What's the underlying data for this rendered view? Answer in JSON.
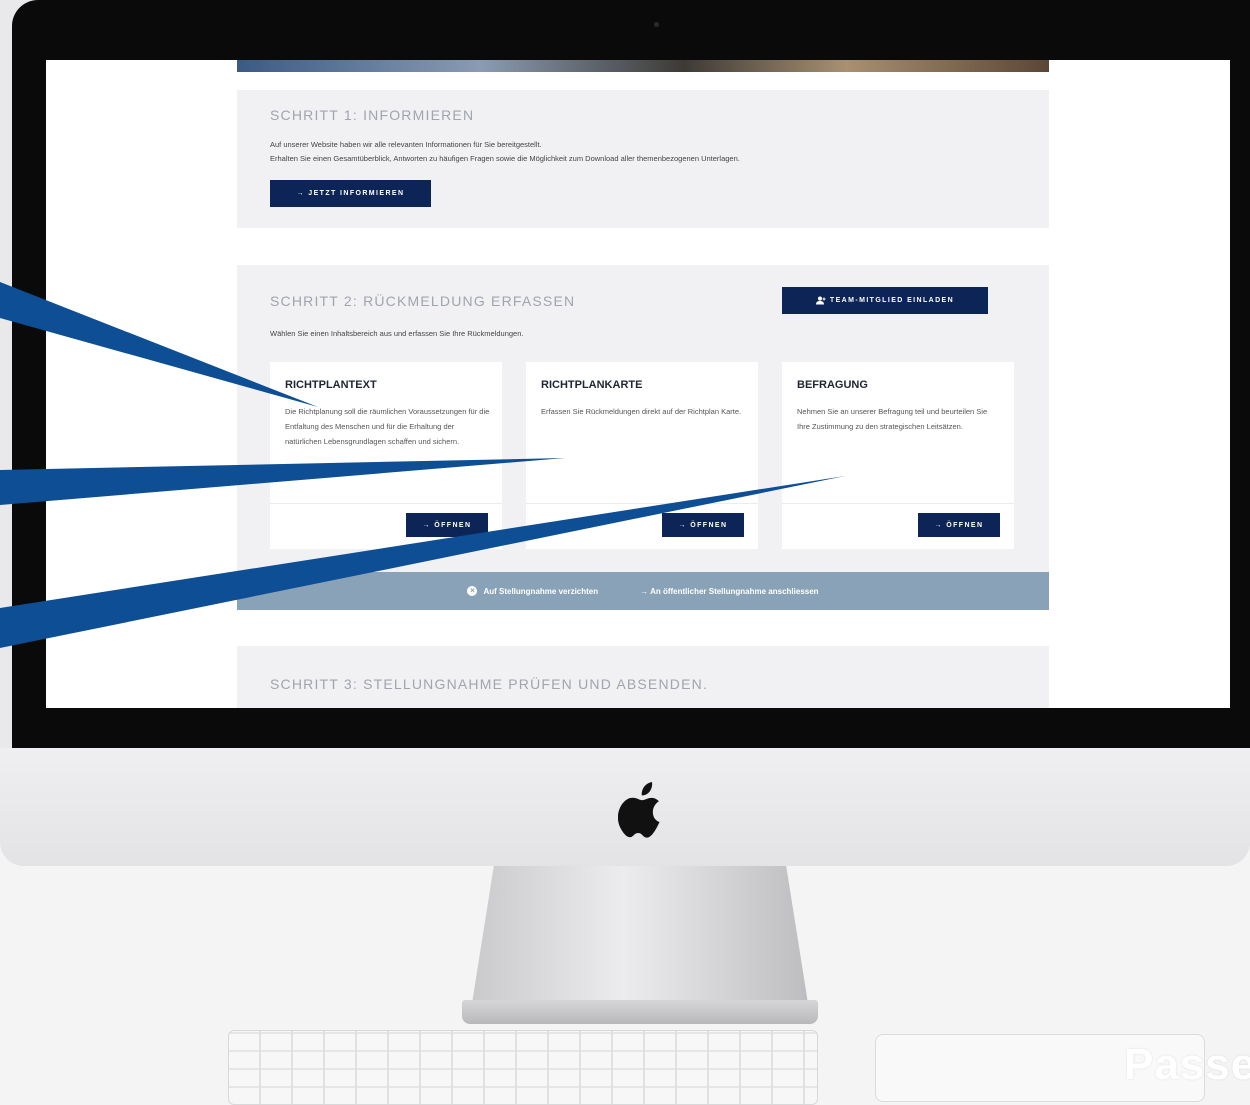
{
  "step1": {
    "title": "SCHRITT 1: INFORMIEREN",
    "line1": "Auf unserer Website haben wir alle relevanten Informationen für Sie bereitgestellt.",
    "line2": "Erhalten Sie einen Gesamtüberblick, Antworten zu häufigen Fragen sowie die Möglichkeit zum Download aller themenbezogenen Unterlagen.",
    "button": "→ JETZT INFORMIEREN"
  },
  "step2": {
    "title": "SCHRITT 2: RÜCKMELDUNG ERFASSEN",
    "invite_button": "TEAM-MITGLIED EINLADEN",
    "intro": "Wählen Sie einen Inhaltsbereich aus und erfassen Sie Ihre Rückmeldungen.",
    "cards": [
      {
        "title": "RICHTPLANTEXT",
        "text": "Die Richtplanung soll die räumlichen Voraussetzungen für die Entfaltung des Menschen und für die Erhaltung der natürlichen Lebensgrundlagen schaffen und sichern.",
        "button": "→ ÖFFNEN"
      },
      {
        "title": "RICHTPLANKARTE",
        "text": "Erfassen Sie Rückmeldungen direkt auf der Richtplan Karte.",
        "button": "→ ÖFFNEN"
      },
      {
        "title": "BEFRAGUNG",
        "text": "Nehmen Sie an unserer Befragung teil und beurteilen Sie Ihre Zustimmung zu den strategischen Leitsätzen.",
        "button": "→ ÖFFNEN"
      }
    ],
    "skip_link": "Auf Stellungnahme verzichten",
    "join_link": "→ An öffentlicher Stellungnahme anschliessen"
  },
  "step3": {
    "title": "SCHRITT 3: STELLUNGNAHME PRÜFEN UND ABSENDEN."
  },
  "watermark": "Passe",
  "colors": {
    "primary": "#0d2456",
    "bar": "#8aa2b8",
    "pointer": "#0e4e94",
    "section_bg": "#f1f1f3",
    "title_gray": "#a0a4ad"
  }
}
